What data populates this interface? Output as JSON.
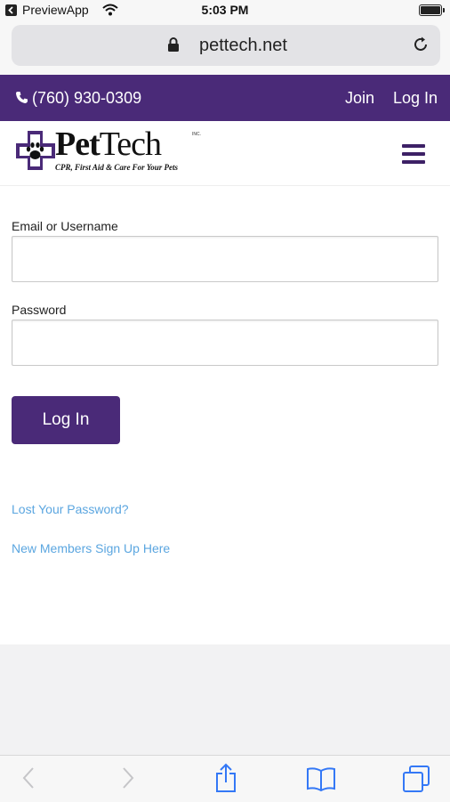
{
  "status_bar": {
    "back_app": "PreviewApp",
    "time": "5:03 PM"
  },
  "browser": {
    "url": "pettech.net"
  },
  "top_bar": {
    "phone": "(760) 930-0309",
    "join": "Join",
    "login": "Log In",
    "color": "#4a2a78"
  },
  "header": {
    "logo_pet": "Pet",
    "logo_tech": "Tech",
    "logo_inc": "INC.",
    "tagline": "CPR, First Aid & Care For Your Pets"
  },
  "form": {
    "email_label": "Email or Username",
    "email_value": "",
    "password_label": "Password",
    "password_value": "",
    "submit_label": "Log In"
  },
  "links": {
    "lost_password": "Lost Your Password?",
    "signup": "New Members Sign Up Here"
  },
  "colors": {
    "brand_purple": "#4a2a78",
    "link_blue": "#5ba6e0",
    "ios_blue": "#3478f6"
  }
}
